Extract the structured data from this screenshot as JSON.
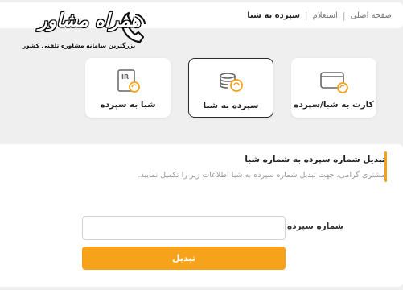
{
  "breadcrumb": {
    "items": [
      "صفحه اصلی",
      "استعلام",
      "سپرده به شبا"
    ],
    "separator": "|"
  },
  "brand": {
    "title": "همراه مشاور",
    "subtitle": "بزرگترین سامانه مشاوره تلفنی کشور"
  },
  "services": [
    {
      "label": "کارت به شبا/سپرده",
      "icon": "card-icon",
      "active": false
    },
    {
      "label": "سپرده به شبا",
      "icon": "coins-exchange-icon",
      "active": true
    },
    {
      "label": "شبا به سپرده",
      "icon": "iban-document-icon",
      "active": false
    }
  ],
  "form": {
    "title": "تبدیل شماره سپرده به شماره شبا",
    "description": "مشتری گرامی، جهت تبدیل شماره سپرده به شبا اطلاعات زیر را تکمیل نمایید.",
    "field_label": "شماره سپرده:",
    "field_value": "",
    "field_placeholder": "",
    "submit_label": "تبدیل"
  },
  "colors": {
    "accent": "#f7a21b",
    "background": "#efefef",
    "active_border": "#2b2b2b"
  }
}
